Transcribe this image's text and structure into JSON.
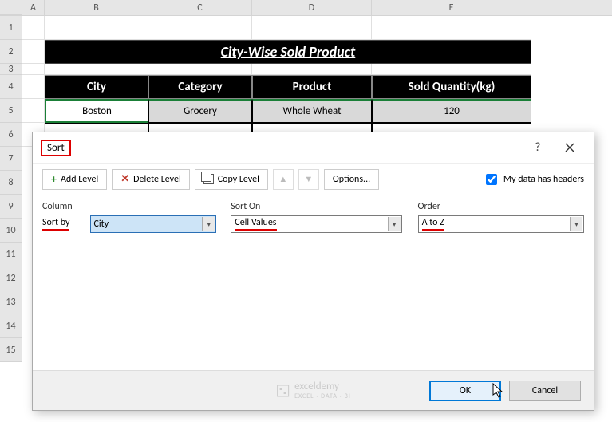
{
  "columns": {
    "A": "A",
    "B": "B",
    "C": "C",
    "D": "D",
    "E": "E"
  },
  "rows": [
    "1",
    "2",
    "3",
    "4",
    "5",
    "6",
    "7",
    "8",
    "9",
    "10",
    "11",
    "12",
    "13",
    "14",
    "15"
  ],
  "title": "City-Wise Sold Product",
  "headers": {
    "city": "City",
    "category": "Category",
    "product": "Product",
    "qty": "Sold Quantity(kg)"
  },
  "data_row": {
    "city": "Boston",
    "category": "Grocery",
    "product": "Whole Wheat",
    "qty": "120"
  },
  "dialog": {
    "title": "Sort",
    "help": "?",
    "toolbar": {
      "add": "Add Level",
      "delete": "Delete Level",
      "copy": "Copy Level",
      "options": "Options...",
      "headers_chk": "My data has headers"
    },
    "labels": {
      "column": "Column",
      "sorton": "Sort On",
      "order": "Order",
      "sortby": "Sort by"
    },
    "values": {
      "column": "City",
      "sorton": "Cell Values",
      "order": "A to Z"
    },
    "buttons": {
      "ok": "OK",
      "cancel": "Cancel"
    },
    "watermark": {
      "name": "exceldemy",
      "sub": "EXCEL · DATA · BI"
    }
  }
}
